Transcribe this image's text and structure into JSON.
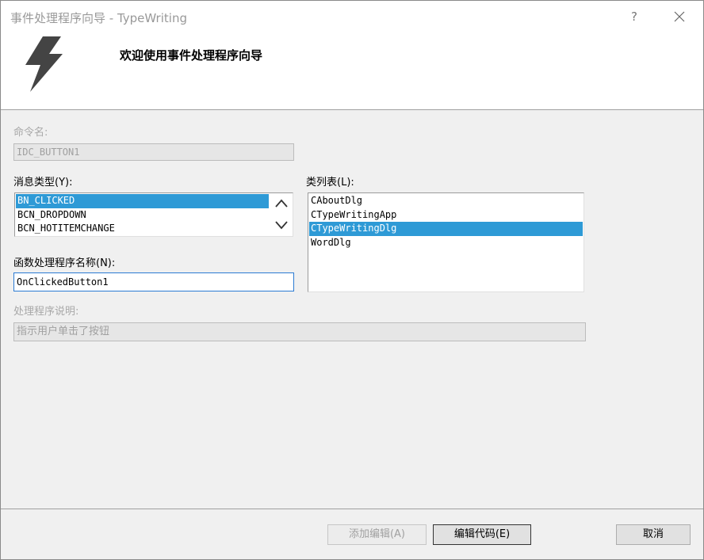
{
  "window": {
    "title": "事件处理程序向导 - TypeWriting",
    "help_glyph": "?"
  },
  "header": {
    "title": "欢迎使用事件处理程序向导",
    "icon": "lightning-bolt-icon"
  },
  "command_name": {
    "label": "命令名:",
    "value": "IDC_BUTTON1"
  },
  "message_type": {
    "label": "消息类型(Y):",
    "items": [
      "BN_CLICKED",
      "BCN_DROPDOWN",
      "BCN_HOTITEMCHANGE"
    ],
    "selected_index": 0
  },
  "class_list": {
    "label": "类列表(L):",
    "items": [
      "CAboutDlg",
      "CTypeWritingApp",
      "CTypeWritingDlg",
      "WordDlg"
    ],
    "selected_index": 2
  },
  "function_name": {
    "label": "函数处理程序名称(N):",
    "value": "OnClickedButton1"
  },
  "handler_desc": {
    "label": "处理程序说明:",
    "value": "指示用户单击了按钮"
  },
  "buttons": {
    "add_edit": "添加编辑(A)",
    "edit_code": "编辑代码(E)",
    "cancel": "取消"
  },
  "colors": {
    "selection": "#2e9ad6",
    "focus_border": "#2b7bd3"
  }
}
